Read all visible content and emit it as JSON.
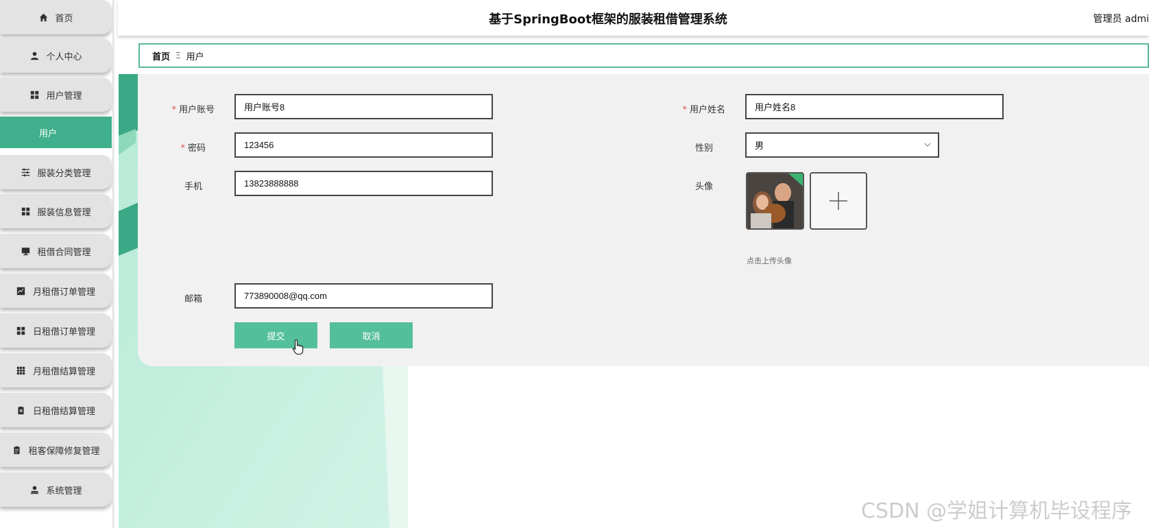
{
  "header": {
    "title": "基于SpringBoot框架的服装租借管理系统",
    "user": "管理员 admi"
  },
  "sidebar": {
    "items": [
      {
        "label": "首页",
        "icon": "home-icon"
      },
      {
        "label": "个人中心",
        "icon": "person-icon"
      },
      {
        "label": "用户管理",
        "icon": "grid-icon"
      },
      {
        "label": "服装分类管理",
        "icon": "sliders-icon"
      },
      {
        "label": "服装信息管理",
        "icon": "grid-icon"
      },
      {
        "label": "租借合同管理",
        "icon": "monitor-icon"
      },
      {
        "label": "月租借订单管理",
        "icon": "chart-icon"
      },
      {
        "label": "日租借订单管理",
        "icon": "grid-icon"
      },
      {
        "label": "月租借结算管理",
        "icon": "apps-icon"
      },
      {
        "label": "日租借结算管理",
        "icon": "clipboard-x-icon"
      },
      {
        "label": "租客保障修复管理",
        "icon": "clipboard-icon"
      },
      {
        "label": "系统管理",
        "icon": "user-icon"
      }
    ],
    "active_sub": "用户"
  },
  "breadcrumb": {
    "home": "首页",
    "separator": "Ξ",
    "current": "用户"
  },
  "form": {
    "account": {
      "label": "用户账号",
      "value": "用户账号8",
      "required": true
    },
    "name": {
      "label": "用户姓名",
      "value": "用户姓名8",
      "required": true
    },
    "password": {
      "label": "密码",
      "value": "123456",
      "required": true
    },
    "gender": {
      "label": "性别",
      "value": "男"
    },
    "phone": {
      "label": "手机",
      "value": "13823888888"
    },
    "avatar": {
      "label": "头像",
      "hint": "点击上传头像"
    },
    "email": {
      "label": "邮箱",
      "value": "773890008@qq.com"
    },
    "submit_label": "提交",
    "cancel_label": "取消",
    "required_mark": "*"
  },
  "colors": {
    "accent": "#3fb08b",
    "button": "#54bf9b",
    "required": "#e04f4f"
  },
  "watermark": "CSDN @学姐计算机毕设程序"
}
